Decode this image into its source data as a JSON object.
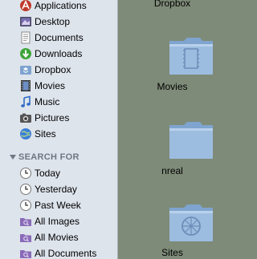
{
  "sidebar": {
    "places": [
      {
        "label": "Applications",
        "icon": "applications-icon"
      },
      {
        "label": "Desktop",
        "icon": "desktop-icon"
      },
      {
        "label": "Documents",
        "icon": "documents-icon"
      },
      {
        "label": "Downloads",
        "icon": "downloads-icon"
      },
      {
        "label": "Dropbox",
        "icon": "dropbox-icon"
      },
      {
        "label": "Movies",
        "icon": "movies-icon"
      },
      {
        "label": "Music",
        "icon": "music-icon"
      },
      {
        "label": "Pictures",
        "icon": "pictures-icon"
      },
      {
        "label": "Sites",
        "icon": "sites-icon"
      }
    ],
    "search_for": {
      "title": "SEARCH FOR",
      "items": [
        {
          "label": "Today",
          "icon": "clock-icon"
        },
        {
          "label": "Yesterday",
          "icon": "clock-icon"
        },
        {
          "label": "Past Week",
          "icon": "clock-icon"
        },
        {
          "label": "All Images",
          "icon": "smart-folder-icon"
        },
        {
          "label": "All Movies",
          "icon": "smart-folder-icon"
        },
        {
          "label": "All Documents",
          "icon": "smart-folder-icon"
        }
      ]
    }
  },
  "main": {
    "items": [
      {
        "label": "Dropbox",
        "icon": "folder-icon"
      },
      {
        "label": "Movies",
        "icon": "movies-folder-icon"
      },
      {
        "label": "nreal",
        "icon": "folder-icon"
      },
      {
        "label": "Sites",
        "icon": "sites-folder-icon"
      }
    ]
  },
  "colors": {
    "sidebar_bg": "#dee4ec",
    "main_bg": "#7e8b78",
    "folder_blue": "#8fb0d4",
    "header_gray": "#6e7782"
  }
}
